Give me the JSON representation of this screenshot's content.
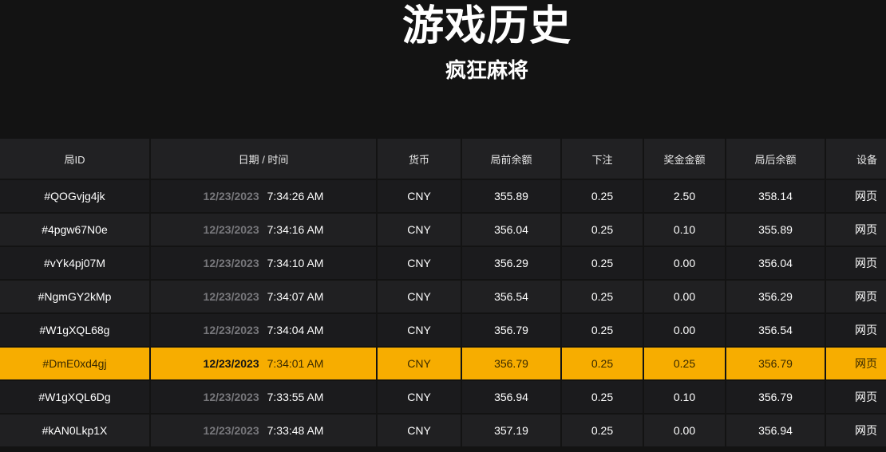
{
  "header": {
    "title": "游戏历史",
    "subtitle": "疯狂麻将"
  },
  "table": {
    "columns": [
      "局ID",
      "日期 / 时间",
      "货币",
      "局前余额",
      "下注",
      "奖金金额",
      "局后余额",
      "设备"
    ],
    "rows": [
      {
        "id": "#QOGvjg4jk",
        "date": "12/23/2023",
        "time": "7:34:26 AM",
        "currency": "CNY",
        "before": "355.89",
        "bet": "0.25",
        "win": "2.50",
        "after": "358.14",
        "device": "网页"
      },
      {
        "id": "#4pgw67N0e",
        "date": "12/23/2023",
        "time": "7:34:16 AM",
        "currency": "CNY",
        "before": "356.04",
        "bet": "0.25",
        "win": "0.10",
        "after": "355.89",
        "device": "网页"
      },
      {
        "id": "#vYk4pj07M",
        "date": "12/23/2023",
        "time": "7:34:10 AM",
        "currency": "CNY",
        "before": "356.29",
        "bet": "0.25",
        "win": "0.00",
        "after": "356.04",
        "device": "网页"
      },
      {
        "id": "#NgmGY2kMp",
        "date": "12/23/2023",
        "time": "7:34:07 AM",
        "currency": "CNY",
        "before": "356.54",
        "bet": "0.25",
        "win": "0.00",
        "after": "356.29",
        "device": "网页"
      },
      {
        "id": "#W1gXQL68g",
        "date": "12/23/2023",
        "time": "7:34:04 AM",
        "currency": "CNY",
        "before": "356.79",
        "bet": "0.25",
        "win": "0.00",
        "after": "356.54",
        "device": "网页"
      },
      {
        "id": "#DmE0xd4gj",
        "date": "12/23/2023",
        "time": "7:34:01 AM",
        "currency": "CNY",
        "before": "356.79",
        "bet": "0.25",
        "win": "0.25",
        "after": "356.79",
        "device": "网页"
      },
      {
        "id": "#W1gXQL6Dg",
        "date": "12/23/2023",
        "time": "7:33:55 AM",
        "currency": "CNY",
        "before": "356.94",
        "bet": "0.25",
        "win": "0.10",
        "after": "356.79",
        "device": "网页"
      },
      {
        "id": "#kAN0Lkp1X",
        "date": "12/23/2023",
        "time": "7:33:48 AM",
        "currency": "CNY",
        "before": "357.19",
        "bet": "0.25",
        "win": "0.00",
        "after": "356.94",
        "device": "网页"
      }
    ],
    "selected_row_id": "#DmE0xd4gj"
  },
  "colors": {
    "background": "#131313",
    "header_cell": "#212123",
    "row_odd": "#1b1b1d",
    "row_even": "#202022",
    "selected_row": "#f7ad00",
    "date_text": "#77777b"
  }
}
